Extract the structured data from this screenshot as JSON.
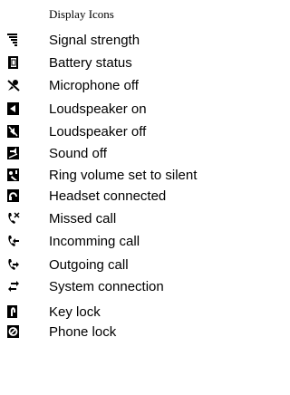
{
  "title": "Display Icons",
  "items": [
    {
      "icon": "signal-strength-icon",
      "label": "Signal strength"
    },
    {
      "icon": "battery-status-icon",
      "label": "Battery status"
    },
    {
      "icon": "microphone-off-icon",
      "label": "Microphone off"
    },
    {
      "icon": "loudspeaker-on-icon",
      "label": "Loudspeaker on"
    },
    {
      "icon": "loudspeaker-off-icon",
      "label": "Loudspeaker off"
    },
    {
      "icon": "sound-off-icon",
      "label": "Sound off"
    },
    {
      "icon": "ring-silent-icon",
      "label": "Ring volume set to silent"
    },
    {
      "icon": "headset-connected-icon",
      "label": "Headset connected"
    },
    {
      "icon": "missed-call-icon",
      "label": "Missed call"
    },
    {
      "icon": "incoming-call-icon",
      "label": "Incomming call"
    },
    {
      "icon": "outgoing-call-icon",
      "label": "Outgoing call"
    },
    {
      "icon": "system-connection-icon",
      "label": "System connection"
    },
    {
      "icon": "key-lock-icon",
      "label": "Key lock"
    },
    {
      "icon": "phone-lock-icon",
      "label": "Phone lock"
    }
  ]
}
